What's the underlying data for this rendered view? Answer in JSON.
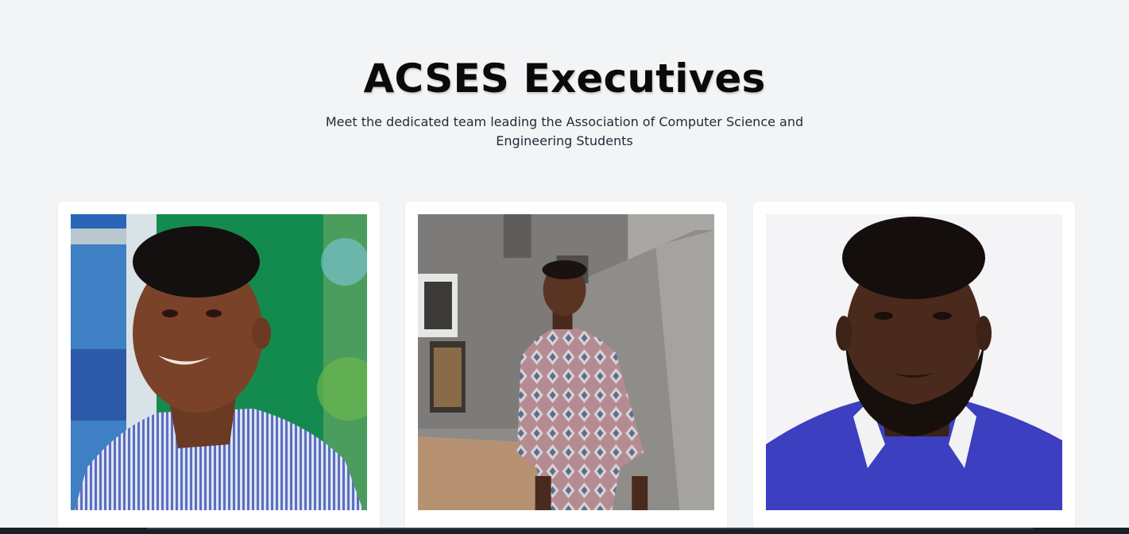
{
  "header": {
    "title": "ACSES Executives",
    "subtitle": "Meet the dedicated team leading the Association of Computer Science and Engineering Students"
  },
  "executives": [
    {
      "photo_alt": "Executive portrait 1"
    },
    {
      "photo_alt": "Executive portrait 2"
    },
    {
      "photo_alt": "Executive portrait 3"
    }
  ],
  "colors": {
    "page_background": "#f3f4f6",
    "card_background": "#ffffff",
    "title_text": "#0a0a0a"
  }
}
